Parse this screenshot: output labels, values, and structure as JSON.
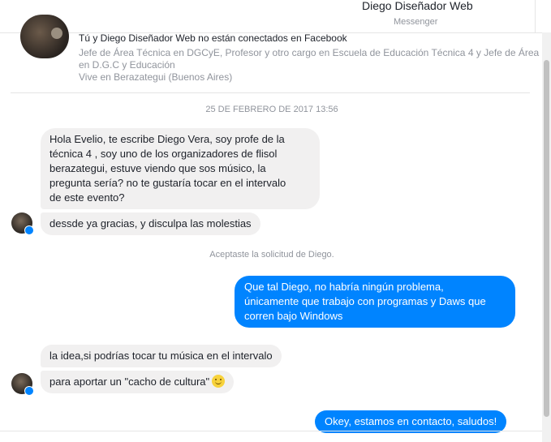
{
  "header": {
    "contact_name": "Diego Diseñador Web",
    "app": "Messenger"
  },
  "profile": {
    "not_connected": "Tú y Diego Diseñador Web no están conectados en Facebook",
    "work_line1": "Jefe de Área Técnica en DGCyE, Profesor y otro cargo en Escuela de Educación Técnica 4 y Jefe de Área",
    "work_line2": "en D.G.C y Educación",
    "lives": "Vive en Berazategui (Buenos Aires)"
  },
  "date_label": "25 DE FEBRERO DE 2017 13:56",
  "system_message": "Aceptaste la solicitud de Diego.",
  "messages": [
    {
      "from": "in",
      "lines": [
        "Hola Evelio, te escribe Diego Vera, soy profe de la",
        "técnica 4 , soy uno de los organizadores de flisol",
        "berazategui, estuve viendo que sos músico, la",
        "pregunta sería? no te gustaría tocar en el intervalo",
        "de este evento?"
      ]
    },
    {
      "from": "in",
      "lines": [
        "dessde ya gracias, y disculpa las molestias"
      ]
    },
    {
      "from": "out",
      "lines": [
        "Que tal Diego, no habría ningún problema,",
        "únicamente que trabajo con programas y Daws que",
        "corren bajo Windows"
      ]
    },
    {
      "from": "in",
      "lines": [
        "la idea,si podrías tocar tu música en el intervalo"
      ]
    },
    {
      "from": "in",
      "lines": [
        "para aportar un \"cacho de cultura\""
      ],
      "emoji": "slightly-smiling-face-emoji"
    },
    {
      "from": "out",
      "lines": [
        "Okey, estamos en contacto, saludos!"
      ]
    }
  ]
}
